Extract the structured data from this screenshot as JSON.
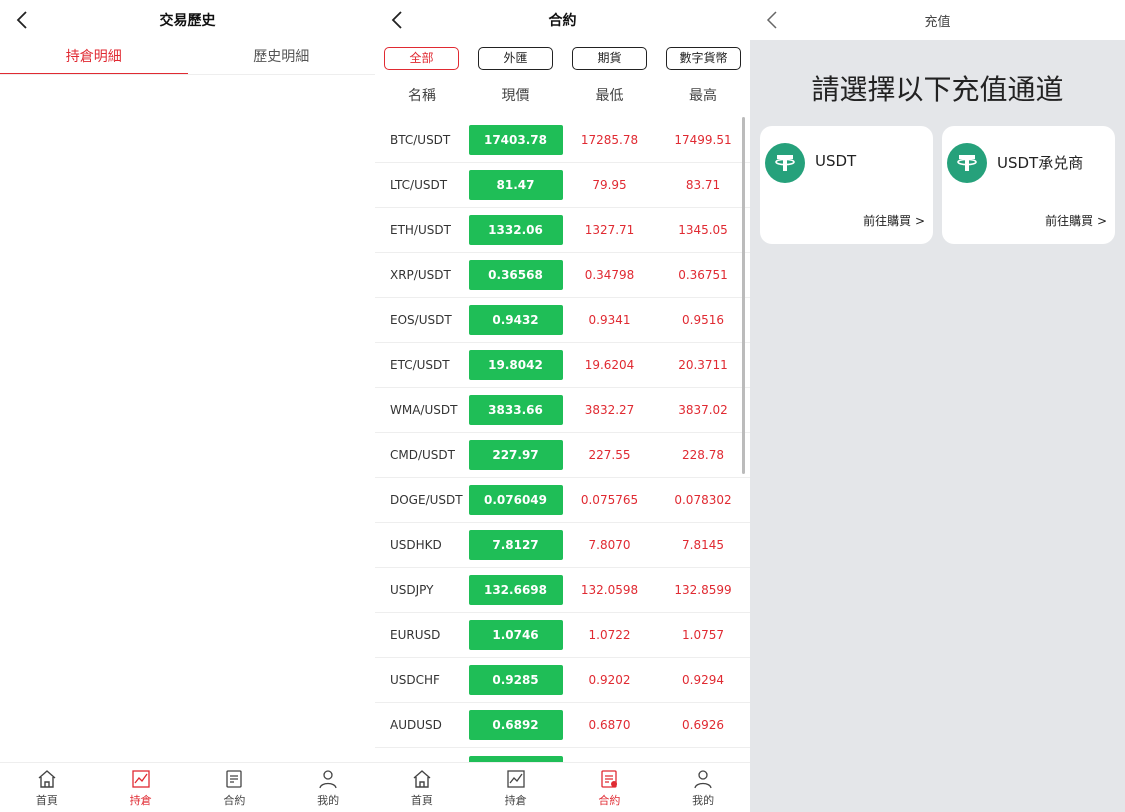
{
  "screen1": {
    "title": "交易歷史",
    "tabs": [
      {
        "label": "持倉明細",
        "active": true
      },
      {
        "label": "歷史明細",
        "active": false
      }
    ]
  },
  "screen2": {
    "title": "合約",
    "filters": [
      {
        "label": "全部",
        "active": true
      },
      {
        "label": "外匯",
        "active": false
      },
      {
        "label": "期貨",
        "active": false
      },
      {
        "label": "數字貨幣",
        "active": false
      }
    ],
    "headers": [
      "名稱",
      "現價",
      "最低",
      "最高"
    ],
    "rows": [
      {
        "name": "BTC/USDT",
        "price": "17403.78",
        "low": "17285.78",
        "high": "17499.51"
      },
      {
        "name": "LTC/USDT",
        "price": "81.47",
        "low": "79.95",
        "high": "83.71"
      },
      {
        "name": "ETH/USDT",
        "price": "1332.06",
        "low": "1327.71",
        "high": "1345.05"
      },
      {
        "name": "XRP/USDT",
        "price": "0.36568",
        "low": "0.34798",
        "high": "0.36751"
      },
      {
        "name": "EOS/USDT",
        "price": "0.9432",
        "low": "0.9341",
        "high": "0.9516"
      },
      {
        "name": "ETC/USDT",
        "price": "19.8042",
        "low": "19.6204",
        "high": "20.3711"
      },
      {
        "name": "WMA/USDT",
        "price": "3833.66",
        "low": "3832.27",
        "high": "3837.02"
      },
      {
        "name": "CMD/USDT",
        "price": "227.97",
        "low": "227.55",
        "high": "228.78"
      },
      {
        "name": "DOGE/USDT",
        "price": "0.076049",
        "low": "0.075765",
        "high": "0.078302"
      },
      {
        "name": "USDHKD",
        "price": "7.8127",
        "low": "7.8070",
        "high": "7.8145"
      },
      {
        "name": "USDJPY",
        "price": "132.6698",
        "low": "132.0598",
        "high": "132.8599"
      },
      {
        "name": "EURUSD",
        "price": "1.0746",
        "low": "1.0722",
        "high": "1.0757"
      },
      {
        "name": "USDCHF",
        "price": "0.9285",
        "low": "0.9202",
        "high": "0.9294"
      },
      {
        "name": "AUDUSD",
        "price": "0.6892",
        "low": "0.6870",
        "high": "0.6926"
      }
    ]
  },
  "screen3": {
    "title": "充值",
    "heading": "請選擇以下充值通道",
    "cards": [
      {
        "name": "USDT",
        "action": "前往購買 >"
      },
      {
        "name": "USDT承兑商",
        "action": "前往購買 >"
      }
    ]
  },
  "tabbar": {
    "home": "首頁",
    "positions": "持倉",
    "contracts": "合約",
    "mine": "我的"
  },
  "colors": {
    "accent": "#e02a32",
    "up": "#1fbe57",
    "tether": "#26a17b"
  }
}
